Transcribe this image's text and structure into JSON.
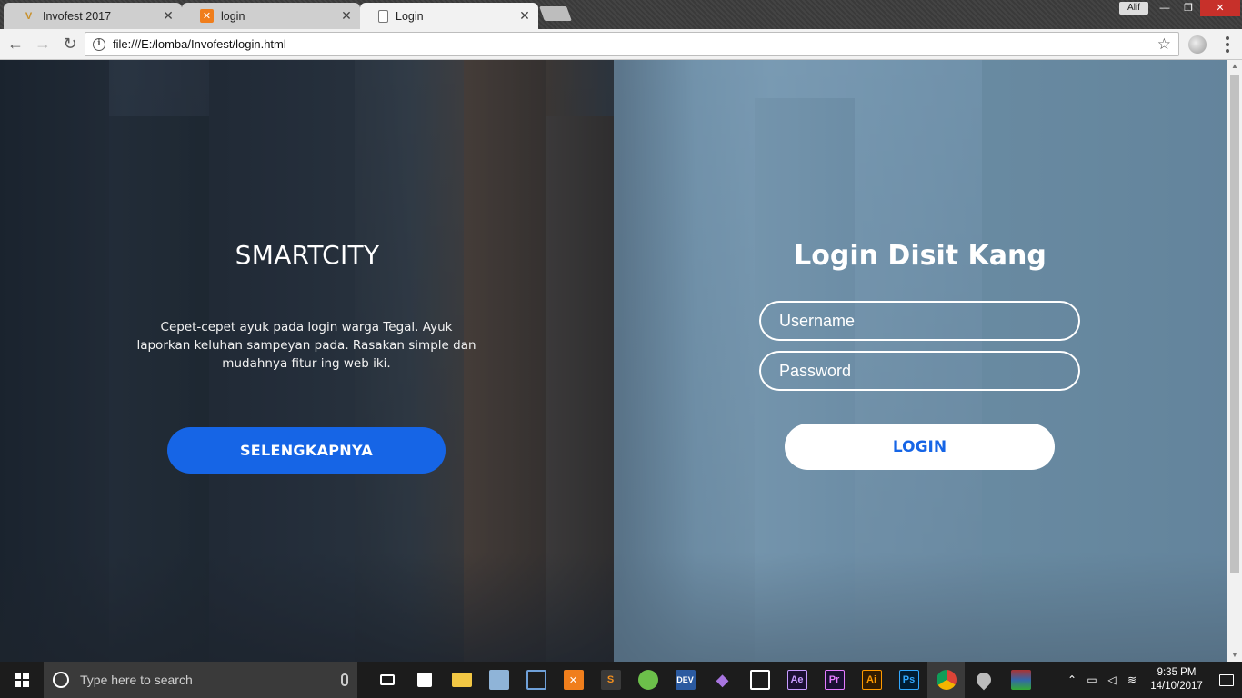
{
  "browser": {
    "tabs": [
      {
        "label": "Invofest 2017",
        "icon": "v-logo-icon",
        "active": false
      },
      {
        "label": "login",
        "icon": "xampp-icon",
        "active": false
      },
      {
        "label": "Login",
        "icon": "page-icon",
        "active": true
      }
    ],
    "user": "Alif",
    "url": "file:///E:/lomba/Invofest/login.html"
  },
  "page": {
    "left": {
      "title": "SMARTCITY",
      "description": "Cepet-cepet ayuk pada login warga Tegal. Ayuk laporkan keluhan sampeyan pada. Rasakan simple dan mudahnya fitur ing web iki.",
      "button_label": "SELENGKAPNYA"
    },
    "right": {
      "title": "Login Disit Kang",
      "username_placeholder": "Username",
      "password_placeholder": "Password",
      "login_label": "LOGIN"
    }
  },
  "taskbar": {
    "search_placeholder": "Type here to search",
    "time": "9:35 PM",
    "date": "14/10/2017"
  },
  "colors": {
    "primary_button": "#1665e6",
    "login_text": "#1665e6",
    "taskbar": "#1c1c1c"
  }
}
